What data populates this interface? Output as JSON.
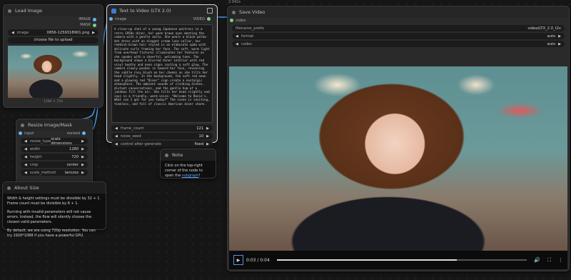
{
  "toolbar": {
    "timer": "2.042s"
  },
  "load_image": {
    "title": "Load Image",
    "outputs": [
      "IMAGE",
      "MASK"
    ],
    "image_widget": {
      "label": "image",
      "value": "0856-1259318901.png"
    },
    "upload_button": "choose file to upload",
    "preview_size": "1280 × 720"
  },
  "resize": {
    "title": "Resize Image/Mask",
    "input_label": "input",
    "output_label": "resized",
    "widgets": [
      {
        "label": "resize_type",
        "value": "scale dimensions"
      },
      {
        "label": "width",
        "value": "1280"
      },
      {
        "label": "height",
        "value": "720"
      },
      {
        "label": "crop",
        "value": "center"
      },
      {
        "label": "scale_method",
        "value": "lanczos"
      }
    ]
  },
  "about": {
    "title": "About Size",
    "paragraphs": [
      "Width & height settings must be divisible by 32 + 1. Frame count must be divisible by 8 + 1.",
      "Running with invalid parameters will not cause errors. Instead, the flow will silently choose the closest valid parameters.",
      "By default, we are using 720p resolution. You can try 1920*1088 if you have a powerful GPU."
    ]
  },
  "t2v": {
    "title": "Text to Video (LTX 2.0)",
    "input_label": "image",
    "output_label": "VIDEO",
    "prompt": "A close-up shot of a young Japanese waitress in a retro 1950s diner, her warm brown eyes meeting the camera with a gentle smile. She wears a black polka-dot dress with an elegant cream lace collar, her reddish-brown hair styled in an elaborate updo with delicate curls framing her face. The soft, warm light from overhead fixtures illuminates her features as she speaks with a cheerful, welcoming tone. The background shows a blurred diner interior with red vinyl booths and neon signs casting a soft glow. The camera slowly pushes in toward her face, revealing the subtle rosy blush on her cheeks as she tilts her head slightly. In the background, the soft red neon and a glowing red \"Diner\" sign create a nostalgic atmosphere. The ambient sounds of clinking dishes, distant conversations, and the gentle hum of a jukebox fill the air. She tilts her head slightly and says in a friendly, warm voice: \"Welcome to Rosie's. What can I get for you today?\" The scene is inviting, timeless, and full of classic American diner charm.",
    "widgets": [
      {
        "label": "frame_count",
        "value": "121"
      },
      {
        "label": "noise_seed",
        "value": "10"
      },
      {
        "label": "control after generate",
        "value": "fixed"
      }
    ]
  },
  "note": {
    "title": "Note",
    "text_before": "Click on the top-right corner of the node to open the ",
    "link": "subgraph",
    "text_after": "!"
  },
  "save_video": {
    "title": "Save Video",
    "input_label": "video",
    "widgets": [
      {
        "label": "filename_prefix",
        "value": "video/LTX_2.0_t2v"
      },
      {
        "label": "format",
        "value": "auto"
      },
      {
        "label": "codec",
        "value": "auto"
      }
    ],
    "player": {
      "time": "0:03 / 0:04",
      "progress": 0.72
    }
  },
  "colors": {
    "link": "#4aa3ff",
    "image_socket": "#64b5f6",
    "video_socket": "#7ecf8a"
  }
}
